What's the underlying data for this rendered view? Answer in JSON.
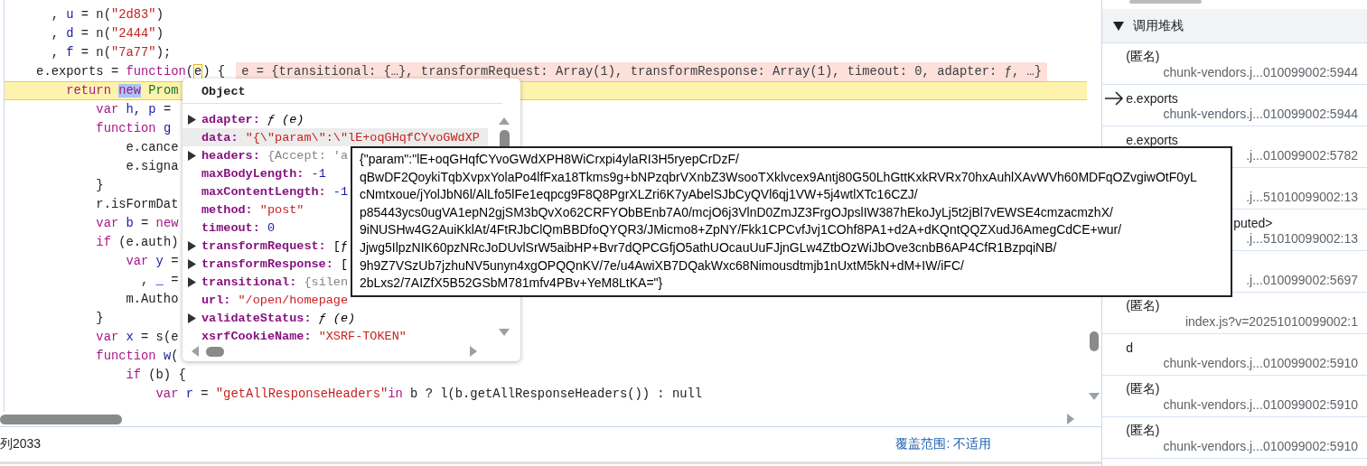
{
  "editor": {
    "lines": [
      {
        "paused": false,
        "tokens": [
          {
            "text": "      , ",
            "kind": "plain"
          },
          {
            "text": "u",
            "kind": "var"
          },
          {
            "text": " = n(",
            "kind": "plain"
          },
          {
            "text": "\"2d83\"",
            "kind": "str"
          },
          {
            "text": ")",
            "kind": "plain"
          }
        ]
      },
      {
        "paused": false,
        "tokens": [
          {
            "text": "      , ",
            "kind": "plain"
          },
          {
            "text": "d",
            "kind": "var"
          },
          {
            "text": " = n(",
            "kind": "plain"
          },
          {
            "text": "\"2444\"",
            "kind": "str"
          },
          {
            "text": ")",
            "kind": "plain"
          }
        ]
      },
      {
        "paused": false,
        "tokens": [
          {
            "text": "      , ",
            "kind": "plain"
          },
          {
            "text": "f",
            "kind": "var"
          },
          {
            "text": " = n(",
            "kind": "plain"
          },
          {
            "text": "\"7a77\"",
            "kind": "str"
          },
          {
            "text": ");",
            "kind": "plain"
          }
        ]
      },
      {
        "paused": false,
        "tokens": [
          {
            "text": "    e.exports = ",
            "kind": "plain"
          },
          {
            "text": "function",
            "kind": "kw"
          },
          {
            "text": "(",
            "kind": "plain"
          },
          {
            "text": "e",
            "kind": "param-box"
          },
          {
            "text": ") {",
            "kind": "plain"
          }
        ],
        "inline_value": "e = {transitional: {…}, transformRequest: Array(1), transformResponse: Array(1), timeout: 0, adapter: ƒ, …}"
      },
      {
        "paused": true,
        "tokens": [
          {
            "text": "        return ",
            "kind": "kw"
          },
          {
            "text": "new",
            "kind": "kw-selected"
          },
          {
            "text": " Prom",
            "kind": "class"
          }
        ]
      },
      {
        "paused": false,
        "tokens": [
          {
            "text": "            var ",
            "kind": "kw"
          },
          {
            "text": "h",
            "kind": "var"
          },
          {
            "text": ", ",
            "kind": "plain"
          },
          {
            "text": "p",
            "kind": "var"
          },
          {
            "text": " =",
            "kind": "plain"
          }
        ]
      },
      {
        "paused": false,
        "tokens": [
          {
            "text": "            function ",
            "kind": "kw"
          },
          {
            "text": "g",
            "kind": "var"
          }
        ]
      },
      {
        "paused": false,
        "tokens": [
          {
            "text": "                e.cance",
            "kind": "plain"
          }
        ]
      },
      {
        "paused": false,
        "tokens": [
          {
            "text": "                e.signa",
            "kind": "plain"
          }
        ]
      },
      {
        "paused": false,
        "tokens": [
          {
            "text": "            }",
            "kind": "plain"
          }
        ]
      },
      {
        "paused": false,
        "tokens": [
          {
            "text": "            r.isFormDat",
            "kind": "plain"
          }
        ]
      },
      {
        "paused": false,
        "tokens": [
          {
            "text": "            var ",
            "kind": "kw"
          },
          {
            "text": "b",
            "kind": "var"
          },
          {
            "text": " = ",
            "kind": "plain"
          },
          {
            "text": "new",
            "kind": "kw"
          }
        ]
      },
      {
        "paused": false,
        "tokens": [
          {
            "text": "            if",
            "kind": "kw"
          },
          {
            "text": " (e.auth)",
            "kind": "plain"
          }
        ]
      },
      {
        "paused": false,
        "tokens": [
          {
            "text": "                var ",
            "kind": "kw"
          },
          {
            "text": "y",
            "kind": "var"
          },
          {
            "text": " =",
            "kind": "plain"
          }
        ]
      },
      {
        "paused": false,
        "tokens": [
          {
            "text": "                  , ",
            "kind": "plain"
          },
          {
            "text": "_",
            "kind": "var"
          },
          {
            "text": " =",
            "kind": "plain"
          }
        ]
      },
      {
        "paused": false,
        "tokens": [
          {
            "text": "                m.Autho",
            "kind": "plain"
          }
        ]
      },
      {
        "paused": false,
        "tokens": [
          {
            "text": "            }",
            "kind": "plain"
          }
        ]
      },
      {
        "paused": false,
        "tokens": [
          {
            "text": "            var ",
            "kind": "kw"
          },
          {
            "text": "x",
            "kind": "var"
          },
          {
            "text": " = s(e",
            "kind": "plain"
          }
        ]
      },
      {
        "paused": false,
        "tokens": [
          {
            "text": "            function ",
            "kind": "kw"
          },
          {
            "text": "w",
            "kind": "var"
          },
          {
            "text": "(",
            "kind": "plain"
          }
        ]
      },
      {
        "paused": false,
        "tokens": [
          {
            "text": "                if",
            "kind": "kw"
          },
          {
            "text": " (b) {",
            "kind": "plain"
          }
        ]
      },
      {
        "paused": false,
        "tokens": [
          {
            "text": "                    var ",
            "kind": "kw"
          },
          {
            "text": "r",
            "kind": "var"
          },
          {
            "text": " = ",
            "kind": "plain"
          },
          {
            "text": "\"getAllResponseHeaders\"",
            "kind": "str"
          },
          {
            "text": "in",
            "kind": "kw"
          },
          {
            "text": " b ? l(b.getAllResponseHeaders()) : null",
            "kind": "plain"
          }
        ]
      }
    ]
  },
  "object_popover": {
    "title": "Object",
    "properties": [
      {
        "key": "adapter:",
        "value": "ƒ (e)",
        "kind": "function",
        "expandable": true,
        "hovered": false
      },
      {
        "key": "data:",
        "value": "\"{\\\"param\\\":\\\"lE+oqGHqfCYvoGWdXP",
        "kind": "string",
        "expandable": false,
        "hovered": true
      },
      {
        "key": "headers:",
        "value": "{Accept: 'a",
        "kind": "object",
        "expandable": true,
        "hovered": false
      },
      {
        "key": "maxBodyLength:",
        "value": "-1",
        "kind": "number",
        "expandable": false,
        "hovered": false
      },
      {
        "key": "maxContentLength:",
        "value": "-1",
        "kind": "number",
        "expandable": false,
        "hovered": false
      },
      {
        "key": "method:",
        "value": "\"post\"",
        "kind": "string",
        "expandable": false,
        "hovered": false
      },
      {
        "key": "timeout:",
        "value": "0",
        "kind": "number",
        "expandable": false,
        "hovered": false
      },
      {
        "key": "transformRequest:",
        "value": "[ƒ",
        "kind": "plain",
        "expandable": true,
        "hovered": false
      },
      {
        "key": "transformResponse:",
        "value": "[",
        "kind": "plain",
        "expandable": true,
        "hovered": false
      },
      {
        "key": "transitional:",
        "value": "{silen",
        "kind": "object",
        "expandable": true,
        "hovered": false
      },
      {
        "key": "url:",
        "value": "\"/open/homepage",
        "kind": "string",
        "expandable": false,
        "hovered": false
      },
      {
        "key": "validateStatus:",
        "value": "ƒ (e)",
        "kind": "function",
        "expandable": true,
        "hovered": false
      },
      {
        "key": "xsrfCookieName:",
        "value": "\"XSRF-TOKEN\"",
        "kind": "string",
        "expandable": false,
        "hovered": false
      }
    ]
  },
  "value_tooltip": {
    "lines": [
      "{\"param\":\"lE+oqGHqfCYvoGWdXPH8WiCrxpi4ylaRI3H5ryepCrDzF/",
      "qBwDF2QoykiTqbXvpxYolaPo4lfFxa18Tkms9g+bNPzqbrVXnbZ3WsooTXklvcex9Antj80G50LhGttKxkRVRx70hxAuhlXAvWVh60MDFqOZvgiwOtF0yL",
      "cNmtxoue/jYolJbN6l/AlLfo5lFe1eqpcg9F8Q8PgrXLZri6K7yAbelSJbCyQVl6qj1VW+5j4wtlXTc16CZJ/",
      "p85443ycs0ugVA1epN2gjSM3bQvXo62CRFYObBEnb7A0/mcjO6j3VlnD0ZmJZ3FrgOJpslIW387hEkoJyLj5t2jBl7vEWSE4cmzacmzhX/",
      "9iNUSHw4G2AuiKklAt/4FtRJbClQmBBDfoQYQR3/JMicmo8+ZpNY/Fkk1CPCvfJvj1COhf8PA1+d2A+dKQntQQZXudJ6AmegCdCE+wur/",
      "Jjwg5IlpzNIK60pzNRcJoDUvlSrW5aibHP+Bvr7dQPCGfjO5athUOcauUuFJjnGLw4ZtbOzWiJbOve3cnbB6AP4CfR1BzpqiNB/",
      "9h9Z7VSzUb7jzhuNV5unyn4xgOPQQnKV/7e/u4AwiXB7DQakWxc68Nimousdtmjb1nUxtM5kN+dM+IW/iFC/",
      "2bLxs2/7AIZfX5B52GSbM781mfv4PBv+YeM8LtKA=\"}"
    ]
  },
  "status_bar": {
    "position": "列2033",
    "coverage": "覆盖范围: 不适用"
  },
  "call_stack": {
    "title": "调用堆栈",
    "expanded": true,
    "frames": [
      {
        "name": "(匿名)",
        "location": "chunk-vendors.j...010099002:5944",
        "current": false,
        "clipped": false
      },
      {
        "name": "e.exports",
        "location": "chunk-vendors.j...010099002:5944",
        "current": true,
        "clipped": false
      },
      {
        "name": "e.exports",
        "location": ".j...010099002:5782",
        "current": false,
        "clipped": false
      },
      {
        "location": ".j...51010099002:13"
      },
      {
        "name": "puted>",
        "location": ".j...51010099002:13",
        "current": false,
        "clipped": true
      },
      {
        "location": ".j...010099002:5697"
      },
      {
        "name": "(匿名)",
        "location": "index.js?v=20251010099002:1",
        "current": false,
        "clipped": false
      },
      {
        "name": "d",
        "location": "chunk-vendors.j...010099002:5910",
        "current": false,
        "clipped": false
      },
      {
        "name": "(匿名)",
        "location": "chunk-vendors.j...010099002:5910",
        "current": false,
        "clipped": false
      },
      {
        "name": "(匿名)",
        "location": "chunk-vendors.j...010099002:5910",
        "current": false,
        "clipped": false
      }
    ]
  }
}
